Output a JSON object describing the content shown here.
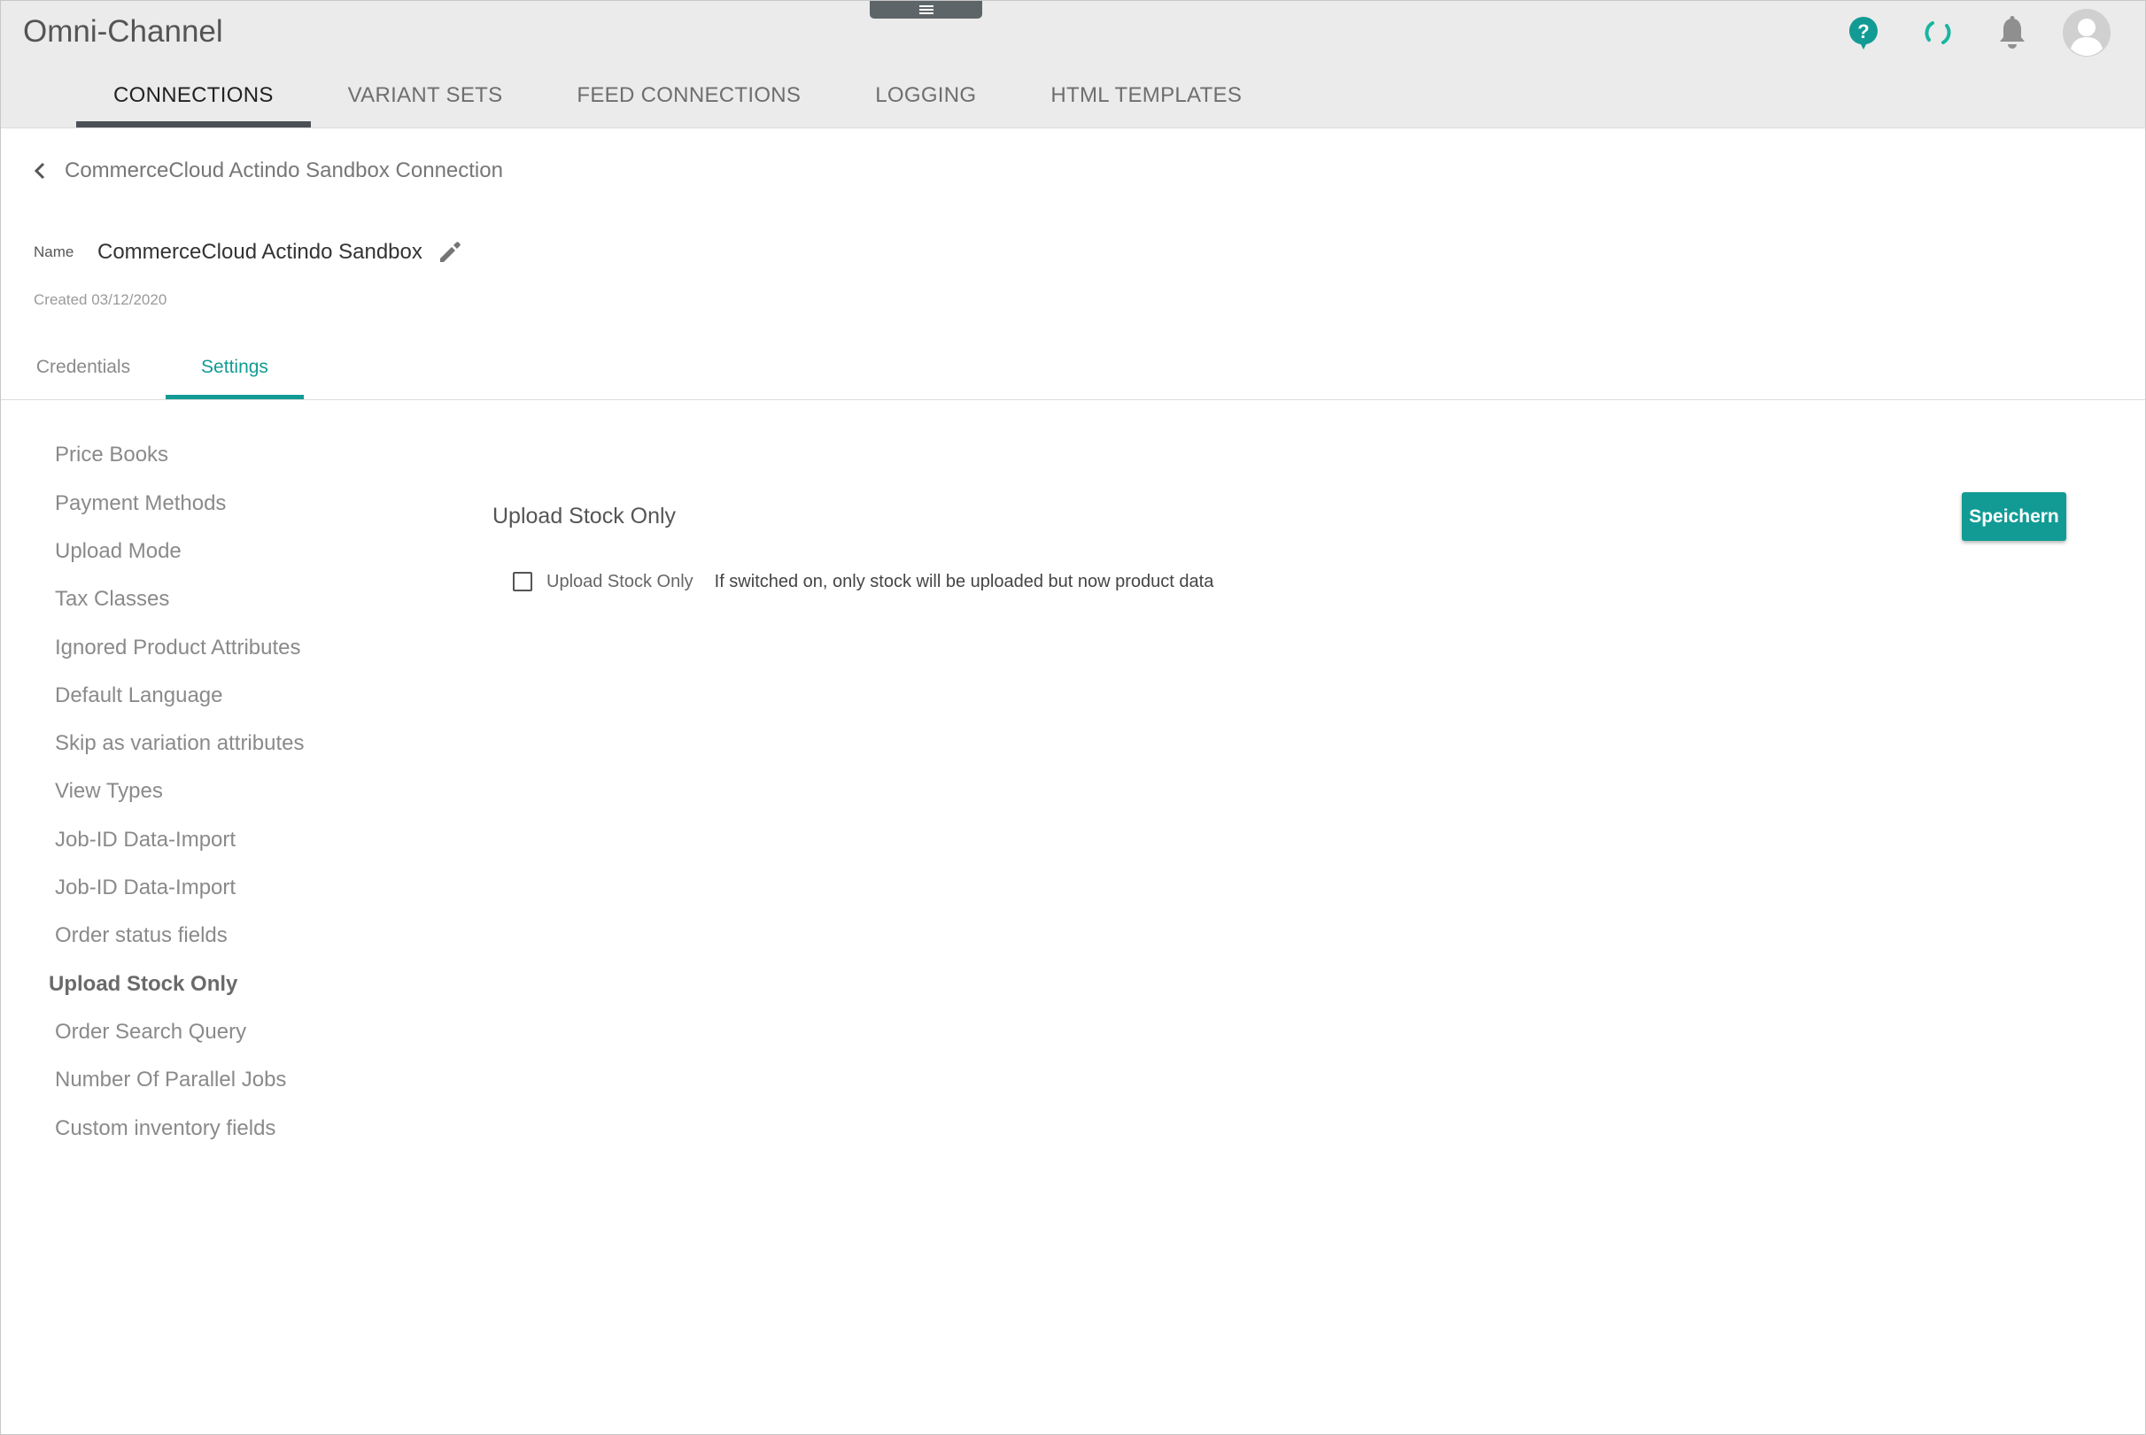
{
  "app": {
    "title": "Omni-Channel"
  },
  "header_icons": [
    {
      "name": "help-icon",
      "color": "#129b94"
    },
    {
      "name": "sync-icon",
      "color": "#1bb5a0"
    },
    {
      "name": "bell-icon",
      "color": "#8f8f8f"
    },
    {
      "name": "avatar-icon",
      "color": "#d0d0d0"
    }
  ],
  "main_nav": {
    "tabs": [
      {
        "label": "CONNECTIONS",
        "active": true
      },
      {
        "label": "VARIANT SETS",
        "active": false
      },
      {
        "label": "FEED CONNECTIONS",
        "active": false
      },
      {
        "label": "LOGGING",
        "active": false
      },
      {
        "label": "HTML TEMPLATES",
        "active": false
      }
    ]
  },
  "breadcrumb": {
    "text": "CommerceCloud Actindo Sandbox Connection"
  },
  "connection": {
    "name_label": "Name",
    "name_value": "CommerceCloud Actindo Sandbox",
    "created": "Created 03/12/2020"
  },
  "sub_tabs": [
    {
      "label": "Credentials",
      "active": false
    },
    {
      "label": "Settings",
      "active": true
    }
  ],
  "side_menu": {
    "items": [
      {
        "label": "Price Books",
        "active": false
      },
      {
        "label": "Payment Methods",
        "active": false
      },
      {
        "label": "Upload Mode",
        "active": false
      },
      {
        "label": "Tax Classes",
        "active": false
      },
      {
        "label": "Ignored Product Attributes",
        "active": false
      },
      {
        "label": "Default Language",
        "active": false
      },
      {
        "label": "Skip as variation attributes",
        "active": false
      },
      {
        "label": "View Types",
        "active": false
      },
      {
        "label": "Job-ID Data-Import",
        "active": false
      },
      {
        "label": "Job-ID Data-Import",
        "active": false
      },
      {
        "label": "Order status fields",
        "active": false
      },
      {
        "label": "Upload Stock Only",
        "active": true
      },
      {
        "label": "Order Search Query",
        "active": false
      },
      {
        "label": "Number Of Parallel Jobs",
        "active": false
      },
      {
        "label": "Custom inventory fields",
        "active": false
      }
    ]
  },
  "panel": {
    "title": "Upload Stock Only",
    "save_label": "Speichern",
    "option": {
      "label": "Upload Stock Only",
      "checked": false,
      "hint": "If switched on, only stock will be uploaded but now product data"
    }
  },
  "colors": {
    "accent": "#129b94",
    "header_bg": "#ebebeb",
    "nav_indicator": "#4a5055"
  }
}
